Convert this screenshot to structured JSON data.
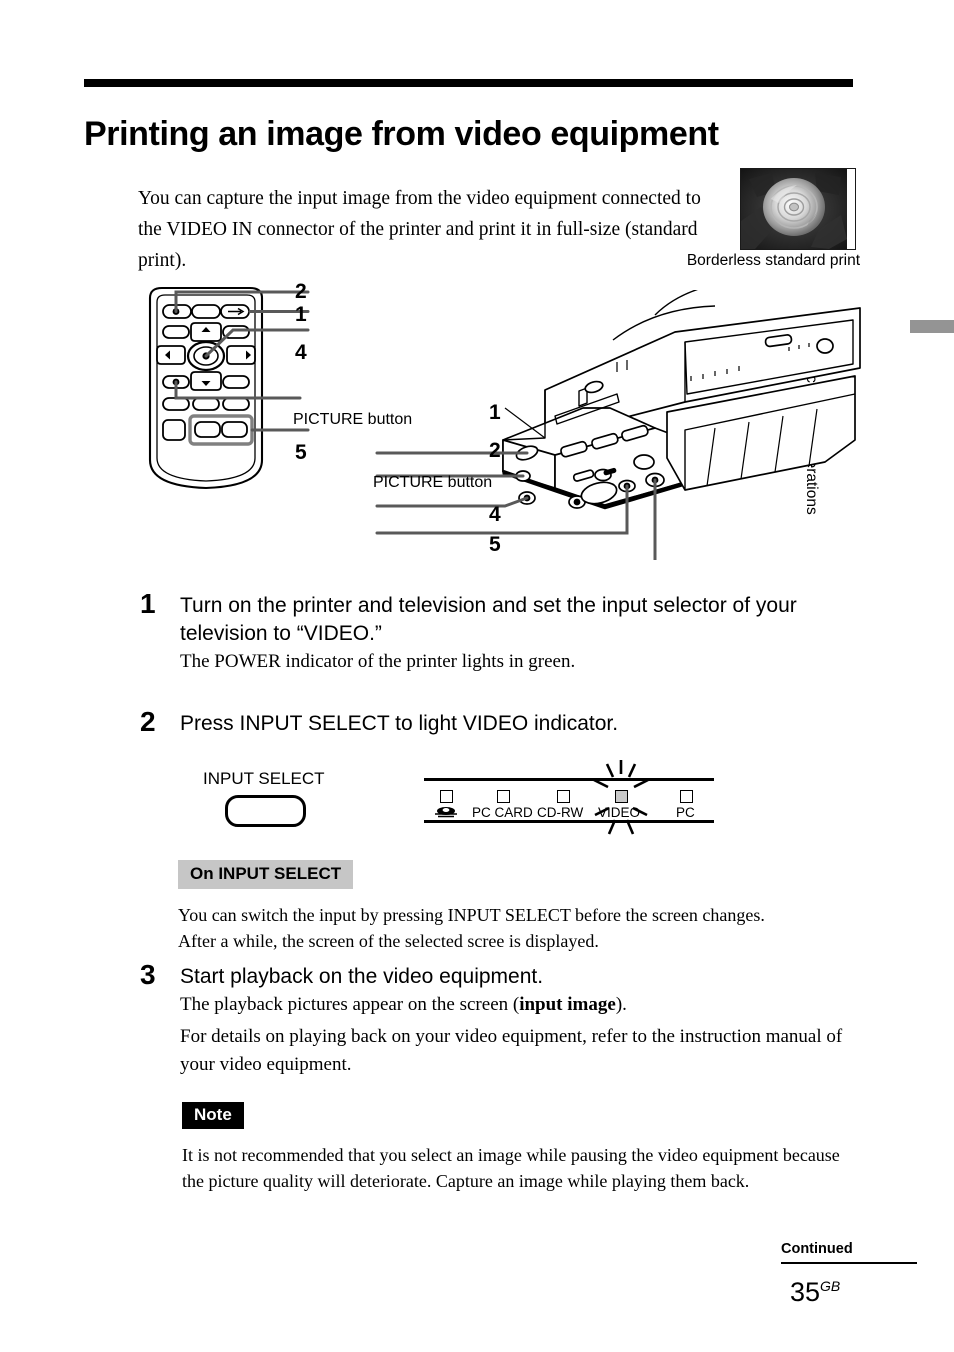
{
  "document": {
    "title": "Printing an image from video equipment",
    "intro": "You can capture the input image from the video equipment connected to the VIDEO IN connector of the printer and print it in full-size (standard print).",
    "thumbnail_caption": "Borderless standard print",
    "side_tab": "Basic printing operations"
  },
  "remote_callouts": {
    "c2": "2",
    "c1": "1",
    "c4": "4",
    "picture_button": "PICTURE button",
    "c5": "5"
  },
  "printer_callouts": {
    "c1": "1",
    "c2": "2",
    "picture_button": "PICTURE button",
    "c4": "4",
    "c5": "5"
  },
  "steps": [
    {
      "number": "1",
      "heading": "Turn on the printer and television and set the input selector of your television to “VIDEO.”",
      "body": "The POWER indicator of the printer lights in green."
    },
    {
      "number": "2",
      "heading": "Press INPUT SELECT to light VIDEO indicator.",
      "body": ""
    },
    {
      "number": "3",
      "heading": "Start playback on the video equipment.",
      "body_1_prefix": "The playback pictures appear on the screen (",
      "body_1_bold": "input image",
      "body_1_suffix": ").",
      "body_2": "For details on playing back on your video equipment, refer to the instruction manual of your video equipment."
    }
  ],
  "input_select": {
    "button_label": "INPUT SELECT",
    "indicators": [
      {
        "label": "",
        "icon": "memory-stick-icon",
        "lit": false
      },
      {
        "label": "PC CARD",
        "icon": "",
        "lit": false
      },
      {
        "label": "CD-RW",
        "icon": "",
        "lit": false
      },
      {
        "label": "VIDEO",
        "icon": "",
        "lit": true
      },
      {
        "label": "PC",
        "icon": "",
        "lit": false
      }
    ]
  },
  "tip_box": {
    "heading": "On INPUT SELECT",
    "line_1": "You can switch the input by pressing INPUT SELECT before the screen changes.",
    "line_2": "After a while, the screen of the selected scree is displayed."
  },
  "note_box": {
    "heading": "Note",
    "text": "It is not recommended that you select an image while pausing the video equipment because the picture quality will  deteriorate.  Capture an image while playing them back."
  },
  "footer": {
    "continued": "Continued",
    "page": "35",
    "page_suffix": "GB"
  },
  "colors": {
    "rule": "#000000",
    "tag_grey": "#c6c6c6",
    "side_tab": "#949494",
    "lit_led": "#c9c9c9"
  }
}
